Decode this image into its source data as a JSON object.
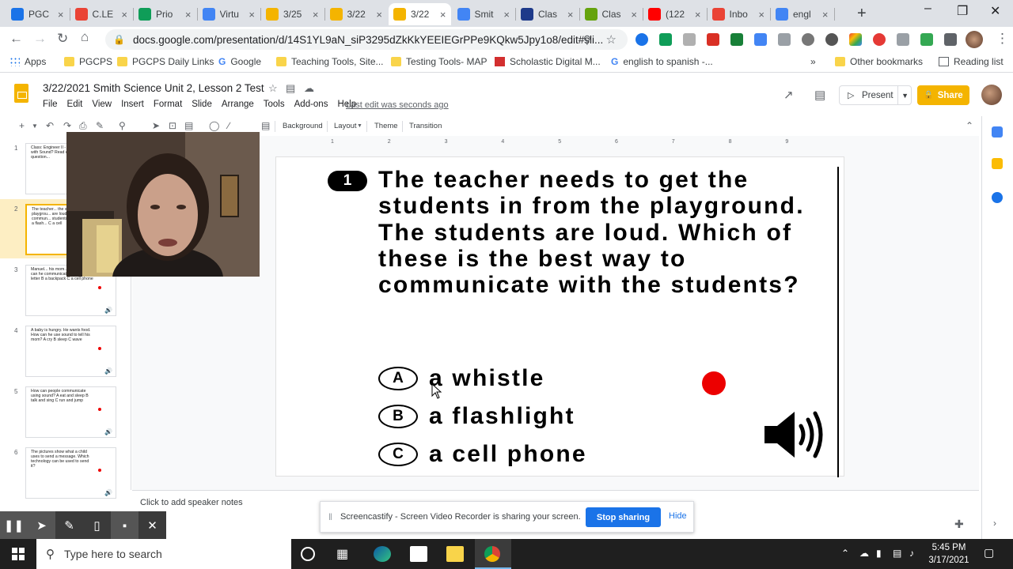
{
  "browser": {
    "tabs": [
      {
        "label": "PGC",
        "icon": "edit-square-icon",
        "color": "#1a73e8"
      },
      {
        "label": "C.LE",
        "icon": "gmail-icon",
        "color": "#ea4335"
      },
      {
        "label": "Prio",
        "icon": "google-drive-icon",
        "color": "#0f9d58"
      },
      {
        "label": "Virtu",
        "icon": "google-docs-icon",
        "color": "#4285f4"
      },
      {
        "label": "3/25",
        "icon": "google-slides-icon",
        "color": "#f4b400"
      },
      {
        "label": "3/22",
        "icon": "google-slides-icon",
        "color": "#f4b400"
      },
      {
        "label": "3/22",
        "icon": "google-slides-icon",
        "color": "#f4b400",
        "active": true
      },
      {
        "label": "Smit",
        "icon": "google-docs-icon",
        "color": "#4285f4"
      },
      {
        "label": "Clas",
        "icon": "classroom-icon",
        "color": "#1e3a8a"
      },
      {
        "label": "Clas",
        "icon": "classdojo-icon",
        "color": "#65a30d"
      },
      {
        "label": "(122",
        "icon": "youtube-icon",
        "color": "#ff0000"
      },
      {
        "label": "Inbo",
        "icon": "gmail-icon",
        "color": "#ea4335"
      },
      {
        "label": "engl",
        "icon": "google-icon",
        "color": "#4285f4"
      }
    ],
    "url": "docs.google.com/presentation/d/14S1YL9aN_siP3295dZkKkYEEIEGrPPe9KQkw5Jpy1o8/edit#sli...",
    "bookmarks": {
      "apps": "Apps",
      "pgcps": "PGCPS",
      "daily_links": "PGCPS Daily Links",
      "google": "Google",
      "teaching_tools": "Teaching Tools, Site...",
      "testing_tools": "Testing Tools- MAP",
      "scholastic": "Scholastic Digital M...",
      "english_spanish": "english to spanish -...",
      "overflow": "»",
      "other": "Other bookmarks",
      "reading_list": "Reading list"
    }
  },
  "docs": {
    "title": "3/22/2021 Smith Science Unit 2, Lesson 2 Test",
    "menu": [
      "File",
      "Edit",
      "View",
      "Insert",
      "Format",
      "Slide",
      "Arrange",
      "Tools",
      "Add-ons",
      "Help"
    ],
    "last_edit": "Last edit was seconds ago",
    "present": "Present",
    "share": "Share",
    "toolbar": {
      "background": "Background",
      "layout": "Layout",
      "theme": "Theme",
      "transition": "Transition"
    },
    "ruler_marks": [
      "1",
      "2",
      "3",
      "4",
      "5",
      "6",
      "7",
      "8",
      "9"
    ],
    "speaker_notes": "Click to add speaker notes"
  },
  "filmstrip": [
    {
      "num": "1",
      "text": "Class: Engineer II - How can... with Sound? Read each question..."
    },
    {
      "num": "2",
      "text": "The teacher... the stud... playgrou... are loud... is the be... commun... students? A a whis... B a flash... C a cell"
    },
    {
      "num": "3",
      "text": "Manuel... his mom... home. How can he communicate with her? A a letter B a backpack C a cell phone"
    },
    {
      "num": "4",
      "text": "A baby is hungry. He wants food. How can he use sound to tell his mom? A cry B sleep C wave"
    },
    {
      "num": "5",
      "text": "How can people communicate using sound? A eat and sleep B talk and sing C run and jump"
    },
    {
      "num": "6",
      "text": "The pictures show what a child uses to send a message. Which technology can be used to send it?"
    }
  ],
  "slide": {
    "question_number": "1",
    "question": "The teacher needs to get the students in from the playground. The students are loud. Which of these is the best way to communicate with the students?",
    "options": [
      {
        "letter": "A",
        "text": "a whistle"
      },
      {
        "letter": "B",
        "text": "a flashlight"
      },
      {
        "letter": "C",
        "text": "a cell phone"
      }
    ],
    "record_dot_color": "#ec0000",
    "speaker_icon": "speaker-volume-icon"
  },
  "screencastify": {
    "message": "Screencastify - Screen Video Recorder is sharing your screen.",
    "stop": "Stop sharing",
    "hide": "Hide"
  },
  "taskbar": {
    "search_placeholder": "Type here to search",
    "time": "5:45 PM",
    "date": "3/17/2021"
  }
}
